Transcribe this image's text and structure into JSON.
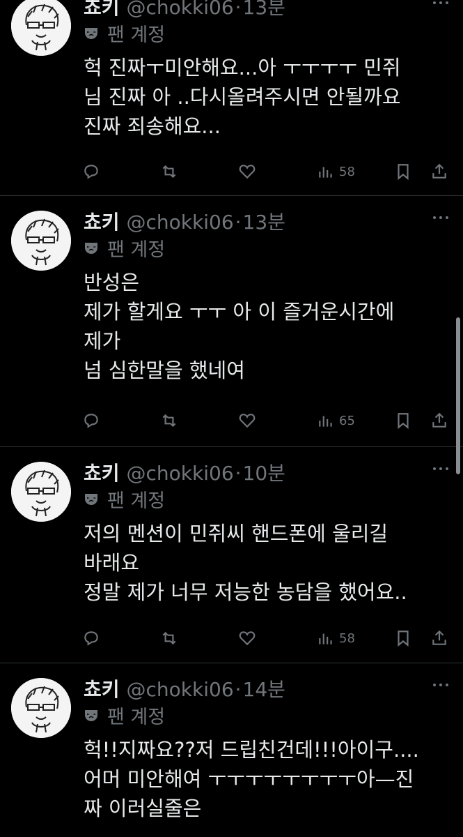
{
  "tweets": [
    {
      "name": "쵸키",
      "handle": "@chokki06",
      "time": "13분",
      "account_label": "팬 계정",
      "text": "헉 진짜ㅜ미안해요...아 ㅜㅜㅜㅜ 민쥐\n님 진짜 아 ..다시올려주시면 안될까요\n진짜 죄송해요...",
      "views": "58"
    },
    {
      "name": "쵸키",
      "handle": "@chokki06",
      "time": "13분",
      "account_label": "팬 계정",
      "text": "반성은\n제가 할게요 ㅜㅜ 아 이 즐거운시간에\n제가\n넘 심한말을 했네여",
      "views": "65"
    },
    {
      "name": "쵸키",
      "handle": "@chokki06",
      "time": "10분",
      "account_label": "팬 계정",
      "text": "저의 멘션이 민쥐씨 핸드폰에 울리길\n바래요\n정말 제가 너무 저능한 농담을 했어요..",
      "views": "58"
    },
    {
      "name": "쵸키",
      "handle": "@chokki06",
      "time": "14분",
      "account_label": "팬 계정",
      "text": "헉!!지짜요??저 드립친건데!!!아이구....\n어머 미안해여 ㅜㅜㅜㅜㅜㅜㅜㅜ아—진\n짜 이러실줄은",
      "views": ""
    }
  ],
  "icons": {
    "reply": "reply-icon",
    "retweet": "retweet-icon",
    "like": "heart-icon",
    "views": "views-icon",
    "bookmark": "bookmark-icon",
    "share": "share-icon",
    "more": "more-icon",
    "account_label": "mask-icon"
  },
  "colors": {
    "background": "#000000",
    "text": "#e7e9ea",
    "secondary": "#71767b",
    "divider": "#2f3336"
  }
}
